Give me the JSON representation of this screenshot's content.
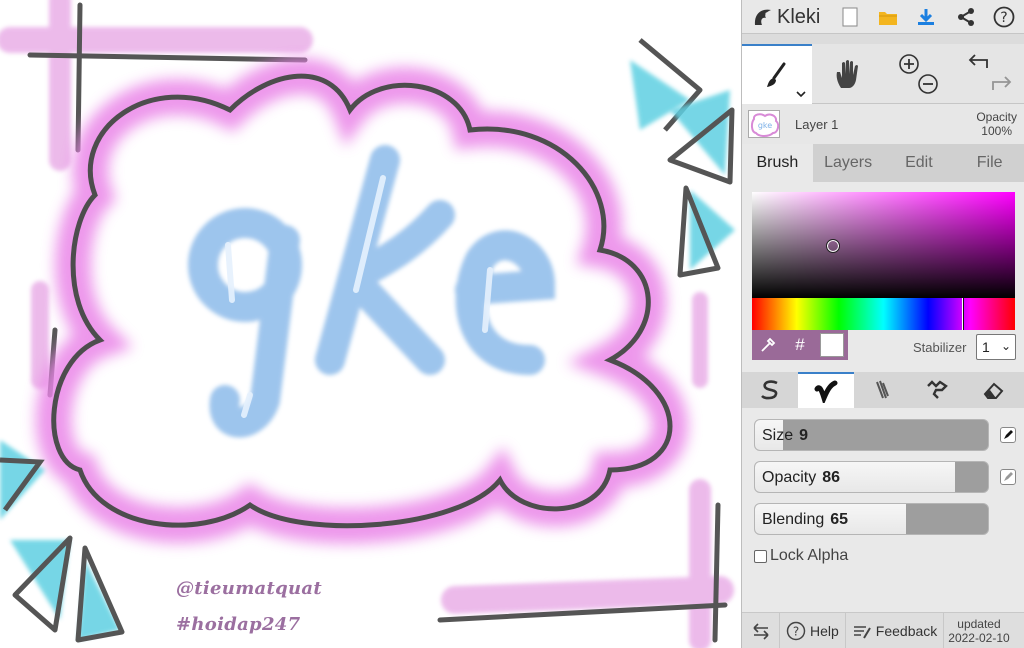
{
  "app": {
    "name": "Kleki"
  },
  "canvas": {
    "watermark_line1": "@tieumatquat",
    "watermark_line2": "#hoidap247",
    "colors": {
      "pink_glow": "#e98ee8",
      "blue_letters": "#8fbcec",
      "cyan_triangles": "#52cfe0",
      "outline": "#4a4a4a"
    }
  },
  "layer": {
    "name": "Layer 1",
    "opacity_label": "Opacity",
    "opacity_value": "100%"
  },
  "tabs": [
    "Brush",
    "Layers",
    "Edit",
    "File"
  ],
  "active_tab": "Brush",
  "color_picker": {
    "hue_color": "#ff00ff",
    "hex_button": "#",
    "secondary_color": "#ffffff",
    "stabilizer_label": "Stabilizer",
    "stabilizer_value": "1"
  },
  "brush_settings": {
    "size": {
      "label": "Size",
      "value": "9",
      "fraction": 0.12
    },
    "opacity": {
      "label": "Opacity",
      "value": "86",
      "fraction": 0.86
    },
    "blending": {
      "label": "Blending",
      "value": "65",
      "fraction": 0.65
    },
    "lock_alpha_label": "Lock Alpha"
  },
  "footer": {
    "help": "Help",
    "feedback": "Feedback",
    "updated_line1": "updated",
    "updated_line2": "2022-02-10"
  }
}
